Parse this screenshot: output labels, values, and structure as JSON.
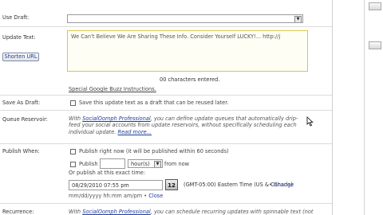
{
  "form": {
    "use_draft": {
      "label": "Use Draft:",
      "value": "",
      "dropdown_arrow": "▼"
    },
    "update_text": {
      "label": "Update Text:",
      "value": "We Can't Believe We Are Sharing These Info. Consider Yourself LUCKY!... http://j",
      "chars_entered": "00 characters entered.",
      "shorten_button": "Shorten URL",
      "instructions_link": "Special Google Buzz Instructions."
    },
    "save_as_draft": {
      "label": "Save As Draft:",
      "checkbox_label": "Save this update text as a draft that can be reused later."
    },
    "queue_reservoir": {
      "label": "Queue Reservoir:",
      "text_before": "With ",
      "link": "SocialOomph Professional",
      "text_after": ", you can define update queues that automatically drip-feed your social accounts from update reservoirs, without specifically scheduling each individual update.",
      "read_more": "Read more..."
    },
    "publish_when": {
      "label": "Publish When:",
      "option_now": "Publish right now (it will be published within 60 seconds)",
      "option_publish": "Publish",
      "unit_select": "hour(s)",
      "from_now": "from now",
      "exact_time_label": "Or publish at this exact time:",
      "date_value": "08/29/2010 07:55 pm",
      "date_format": "mm/dd/yyyy hh:mm am/pm",
      "close_link": "Close",
      "calendar_icon_text": "12",
      "timezone": "(GMT-05:00) Eastern Time (US & Canada)",
      "change_link": "Change"
    },
    "recurrence": {
      "label": "Recurrence:",
      "text_before": "With ",
      "link": "SocialOomph Professional",
      "text_after": ", you can schedule recurring updates with spinnable text (not"
    }
  },
  "icons": {
    "cursor": "mouse-pointer-icon",
    "calendar": "calendar-icon"
  }
}
